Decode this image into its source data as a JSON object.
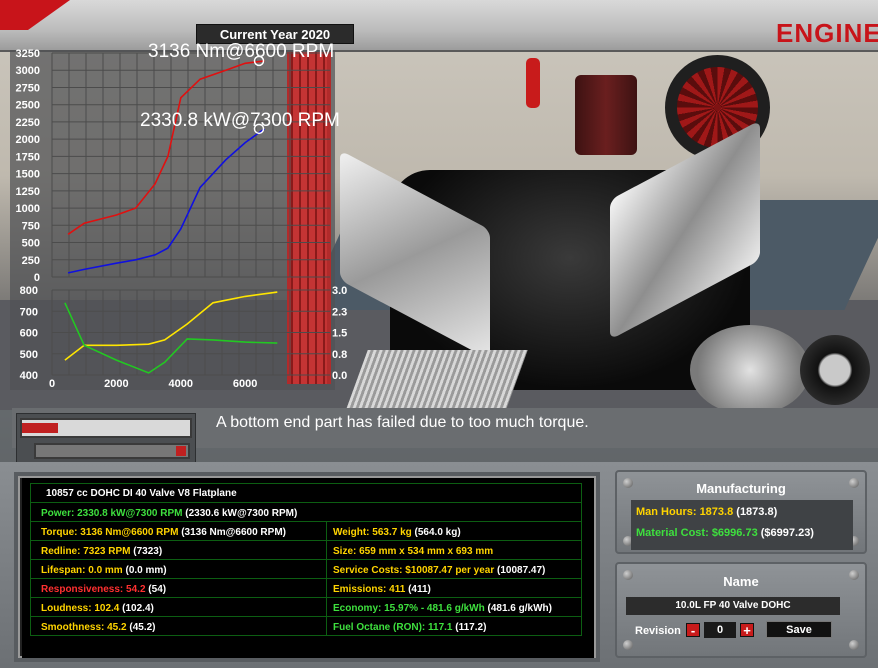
{
  "header": {
    "current_year": "Current Year 2020",
    "title": "ENGINE D"
  },
  "chart_data": [
    {
      "type": "line",
      "title": "",
      "x": [
        500,
        1000,
        2000,
        2600,
        3200,
        3600,
        4000,
        4600,
        5400,
        6000,
        6600
      ],
      "series": [
        {
          "name": "Torque",
          "color": "#e01010",
          "values": [
            620,
            780,
            900,
            1000,
            1350,
            1750,
            2600,
            2870,
            3000,
            3100,
            3136
          ]
        },
        {
          "name": "Power",
          "color": "#1010e0",
          "values": [
            60,
            110,
            200,
            250,
            320,
            420,
            700,
            1300,
            1700,
            1950,
            2150
          ]
        }
      ],
      "y_ticks": [
        "3250",
        "3000",
        "2750",
        "2500",
        "2250",
        "2000",
        "1750",
        "1500",
        "1250",
        "1000",
        "750",
        "500",
        "250",
        "0"
      ],
      "ylim": [
        0,
        3250
      ],
      "annotations": [
        "3136 Nm@6600 RPM",
        "2330.8 kW@7300 RPM"
      ],
      "grid": true
    },
    {
      "type": "line",
      "title": "",
      "x": [
        400,
        1000,
        2000,
        3000,
        3500,
        4200,
        5000,
        6000,
        7000
      ],
      "series": [
        {
          "name": "Yellow",
          "color": "#ffe600",
          "values": [
            470,
            540,
            540,
            545,
            565,
            640,
            740,
            770,
            790
          ]
        },
        {
          "name": "Green",
          "color": "#22c822",
          "values": [
            740,
            540,
            470,
            410,
            460,
            570,
            565,
            555,
            550
          ]
        }
      ],
      "y_ticks_left": [
        "800",
        "700",
        "600",
        "500",
        "400"
      ],
      "y_ticks_right": [
        "3.0",
        "2.3",
        "1.5",
        "0.8",
        "0.0"
      ],
      "x_ticks": [
        "0",
        "2000",
        "4000",
        "6000"
      ],
      "ylim": [
        400,
        800
      ],
      "grid": true
    }
  ],
  "message": "A bottom end part has failed due to too much torque.",
  "stats": {
    "heading": "10857 cc DOHC DI 40 Valve V8 Flatplane",
    "rows": [
      {
        "label": "Power:",
        "value": "2330.8 kW@7300 RPM",
        "extra": "(2330.6 kW@7300 RPM)",
        "color": "green"
      },
      {
        "label": "Torque:",
        "value": "3136 Nm@6600 RPM",
        "extra": "(3136 Nm@6600 RPM)",
        "color": "yellow"
      },
      {
        "label": "Redline:",
        "value": "7323 RPM",
        "extra": "(7323)",
        "color": "yellow"
      },
      {
        "label": "Lifespan:",
        "value": "0.0 mm",
        "extra": "(0.0 mm)",
        "color": "yellow"
      },
      {
        "label": "Responsiveness:",
        "value": "54.2",
        "extra": "(54)",
        "color": "red"
      },
      {
        "label": "Loudness:",
        "value": "102.4",
        "extra": "(102.4)",
        "color": "yellow"
      },
      {
        "label": "Smoothness:",
        "value": "45.2",
        "extra": "(45.2)",
        "color": "yellow"
      }
    ],
    "rows_right": [
      {
        "label": "Weight:",
        "value": "563.7 kg",
        "extra": "(564.0 kg)",
        "color": "yellow"
      },
      {
        "label": "Size:",
        "value": "659 mm x 534 mm x 693 mm",
        "extra": "",
        "color": "yellow"
      },
      {
        "label": "Service Costs:",
        "value": "$10087.47 per year",
        "extra": "(10087.47)",
        "color": "yellow"
      },
      {
        "label": "Emissions:",
        "value": "411",
        "extra": "(411)",
        "color": "yellow"
      },
      {
        "label": "Economy:",
        "value": "15.97% - 481.6 g/kWh",
        "extra": "(481.6 g/kWh)",
        "color": "green"
      },
      {
        "label": "Fuel Octane (RON):",
        "value": "117.1",
        "extra": "(117.2)",
        "color": "green"
      }
    ]
  },
  "manufacturing": {
    "title": "Manufacturing",
    "man_hours_label": "Man Hours:",
    "man_hours_value": "1873.8",
    "man_hours_extra": "(1873.8)",
    "material_label": "Material Cost:",
    "material_value": "$6996.73",
    "material_extra": "($6997.23)"
  },
  "name_panel": {
    "title": "Name",
    "engine_name": "10.0L FP 40 Valve DOHC",
    "revision_label": "Revision",
    "revision_value": "0",
    "minus": "-",
    "plus": "+",
    "save_label": "Save"
  },
  "colors": {
    "accent_red": "#c8141a",
    "label_yellow": "#ffd400",
    "label_green": "#3ee03e",
    "label_red": "#ff3030"
  }
}
